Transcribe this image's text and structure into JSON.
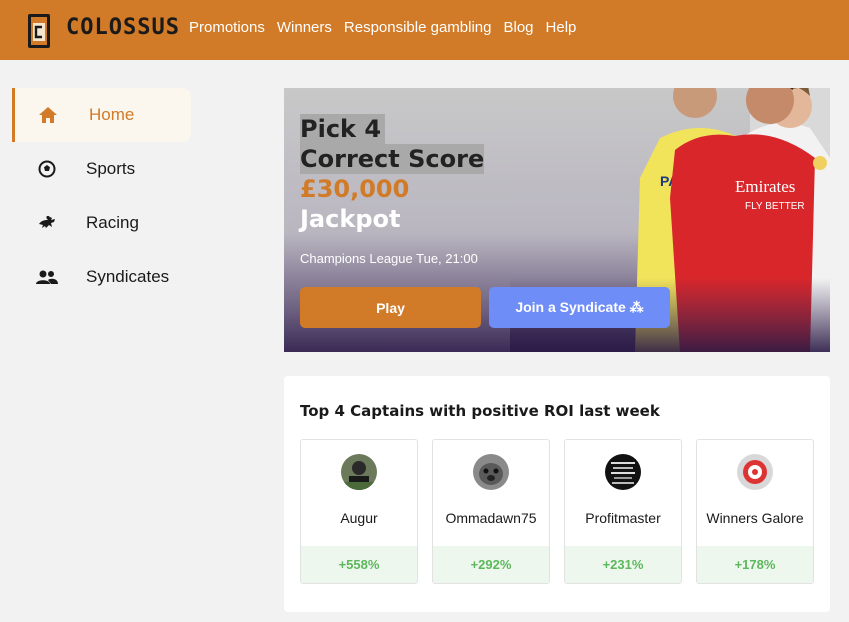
{
  "brand": {
    "name": "COLOSSUS",
    "accent": "#d17a27"
  },
  "nav": [
    "Promotions",
    "Winners",
    "Responsible gambling",
    "Blog",
    "Help"
  ],
  "sidebar": {
    "items": [
      {
        "label": "Home",
        "icon": "home-icon",
        "active": true
      },
      {
        "label": "Sports",
        "icon": "soccer-ball-icon",
        "active": false
      },
      {
        "label": "Racing",
        "icon": "horse-racing-icon",
        "active": false
      },
      {
        "label": "Syndicates",
        "icon": "users-icon",
        "active": false
      }
    ]
  },
  "hero": {
    "line1": "Pick 4",
    "line2": "Correct Score",
    "amount": "£30,000",
    "jackpot": "Jackpot",
    "subtitle": "Champions League Tue, 21:00",
    "play_label": "Play",
    "syndicate_label": "Join a Syndicate ⁂"
  },
  "captains": {
    "title": "Top 4 Captains with positive ROI last week",
    "items": [
      {
        "name": "Augur",
        "roi": "+558%"
      },
      {
        "name": "Ommadawn75",
        "roi": "+292%"
      },
      {
        "name": "Profitmaster",
        "roi": "+231%"
      },
      {
        "name": "Winners Galore",
        "roi": "+178%"
      }
    ]
  }
}
